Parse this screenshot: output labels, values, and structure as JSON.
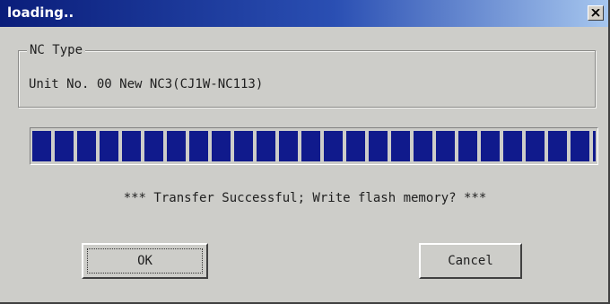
{
  "window": {
    "title": "loading..",
    "close_icon": "close-icon"
  },
  "group": {
    "legend": "NC Type",
    "unit_text": "Unit No. 00 New NC3(CJ1W-NC113)"
  },
  "progress": {
    "value_percent": 100
  },
  "message": "*** Transfer Successful; Write flash memory? ***",
  "buttons": {
    "ok_label": "OK",
    "cancel_label": "Cancel"
  },
  "colors": {
    "title_bar_start": "#0a1d7a",
    "title_bar_end": "#a6c6ee",
    "progress_fill": "#101a8c",
    "dialog_bg": "#cdcdc9"
  }
}
